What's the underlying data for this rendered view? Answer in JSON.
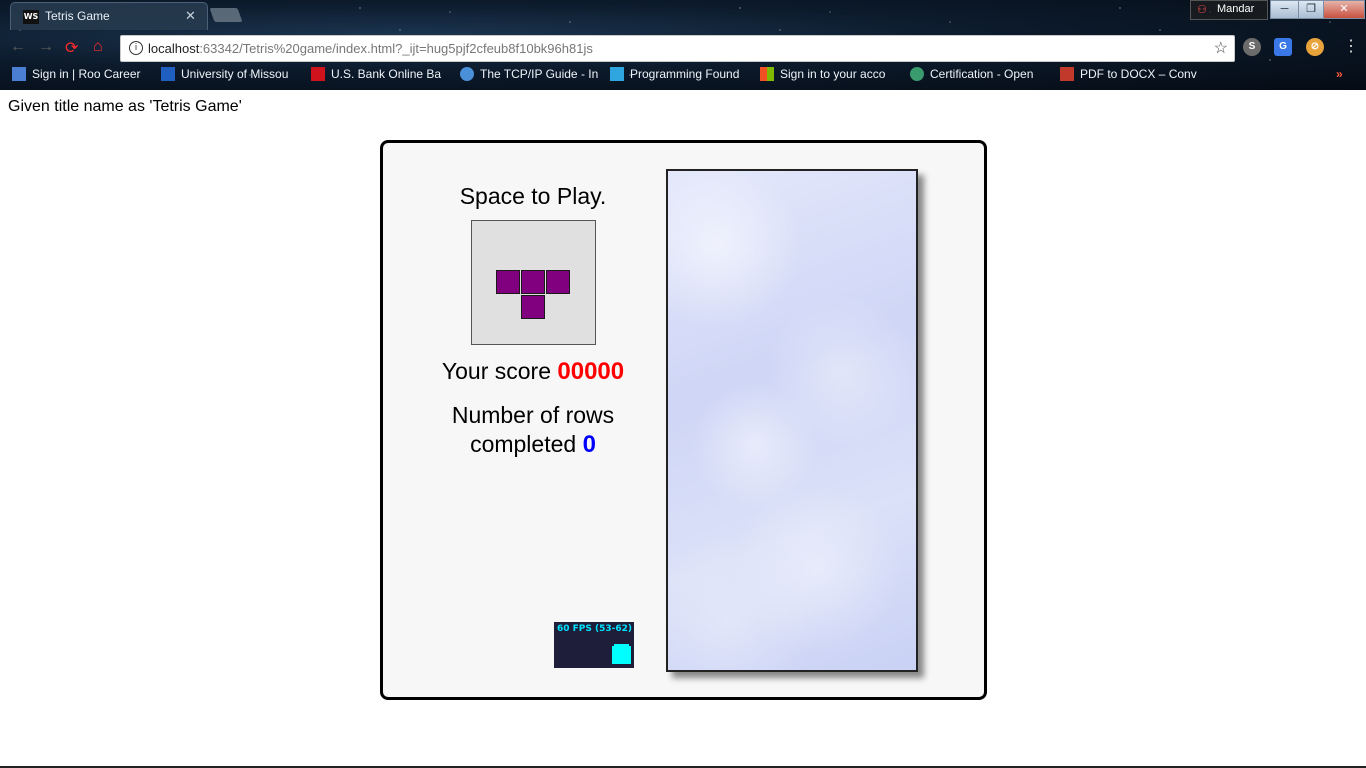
{
  "browser": {
    "tab": {
      "icon_text": "WS",
      "title": "Tetris Game"
    },
    "profile": {
      "name": "Mandar"
    },
    "window_controls": {
      "minimize": "─",
      "restore": "❐",
      "close": "✕"
    },
    "nav": {
      "back": "←",
      "forward": "→",
      "reload": "⟳",
      "home": "⌂"
    },
    "address": {
      "host": "localhost",
      "path": ":63342/Tetris%20game/index.html?_ijt=hug5pjf2cfeub8f10bk96h81js",
      "info_icon": "i",
      "star_icon": "☆"
    },
    "extensions": [
      "S",
      "G",
      "⊘"
    ],
    "menu_icon": "⋮",
    "bookmarks": [
      {
        "label": "Sign in | Roo Career",
        "color": "#4a7fd4"
      },
      {
        "label": "University of Missou",
        "color": "#1f5fbf"
      },
      {
        "label": "U.S. Bank Online Ba",
        "color": "#d0121c"
      },
      {
        "label": "The TCP/IP Guide - In",
        "color": "#4a90d9"
      },
      {
        "label": "Programming Found",
        "color": "#2fa6e0"
      },
      {
        "label": "Sign in to your acco",
        "color": "#f25022"
      },
      {
        "label": "Certification - Open",
        "color": "#3a9b6e"
      },
      {
        "label": "PDF to DOCX – Conv",
        "color": "#c0392b"
      }
    ],
    "bookmark_overflow": "»"
  },
  "page": {
    "note": "Given title name as 'Tetris Game'"
  },
  "game": {
    "prompt": "Space to Play.",
    "next_piece": {
      "color": "#800080",
      "shape": "T"
    },
    "score_label": "Your score",
    "score_value": "00000",
    "rows_label_line1": "Number of rows",
    "rows_label_line2": "completed",
    "rows_value": "0",
    "fps_text": "60 FPS (53-62)"
  }
}
